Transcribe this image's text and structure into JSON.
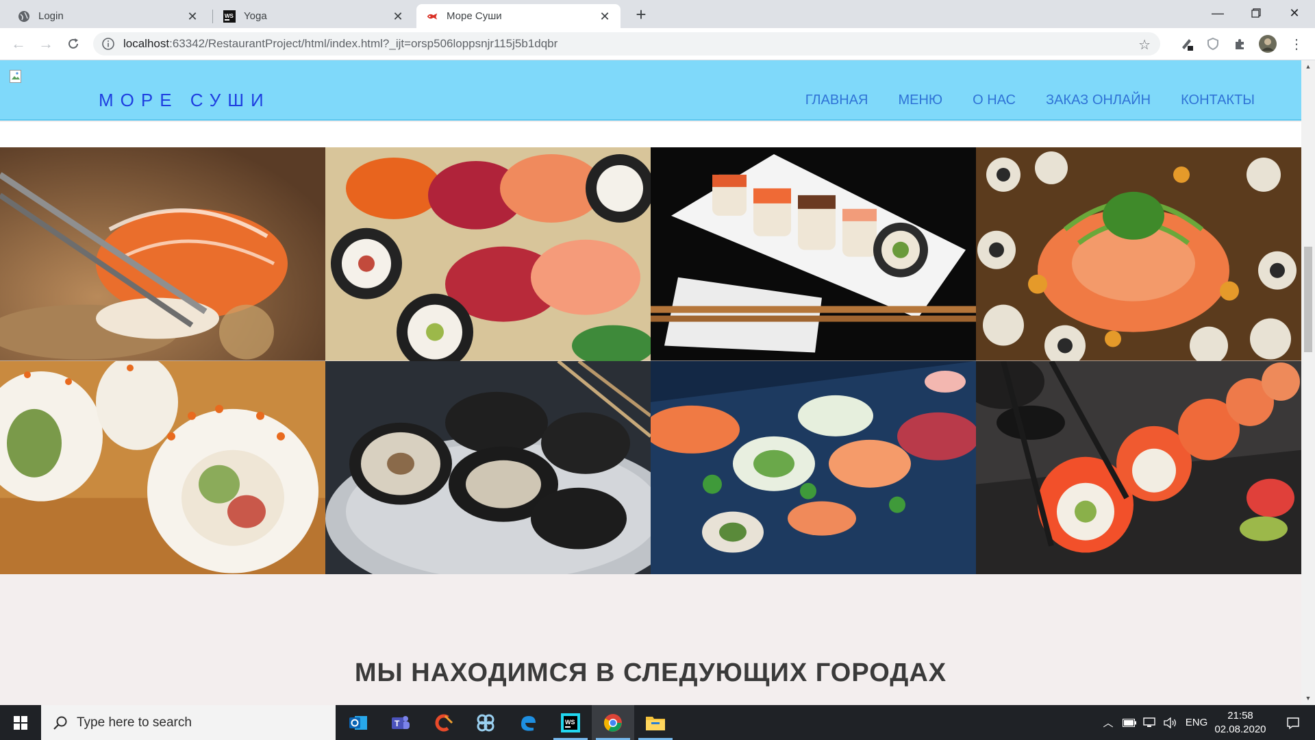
{
  "browser": {
    "tabs": [
      {
        "title": "Login",
        "icon": "globe-icon"
      },
      {
        "title": "Yoga",
        "icon": "webstorm-icon"
      },
      {
        "title": "Море Суши",
        "icon": "site-favicon-icon",
        "active": true
      }
    ],
    "url": {
      "host": "localhost",
      "rest": ":63342/RestaurantProject/html/index.html?_ijt=orsp506loppsnjr115j5b1dqbr"
    }
  },
  "site": {
    "brand": "МОРЕ СУШИ",
    "nav": [
      "ГЛАВНАЯ",
      "МЕНЮ",
      "О НАС",
      "ЗАКАЗ ОНЛАЙН",
      "КОНТАКТЫ"
    ],
    "cities_title": "МЫ НАХОДИМСЯ В СЛЕДУЮЩИХ ГОРОДАХ",
    "gallery": [
      "salmon-nigiri-chopsticks-photo",
      "assorted-sushi-platter-photo",
      "sushi-plate-black-background-photo",
      "sushi-rolls-salmon-set-photo",
      "california-rolls-closeup-photo",
      "dark-maki-rolls-plate-photo",
      "sushi-on-slate-photo",
      "salmon-roll-chopsticks-photo"
    ]
  },
  "taskbar": {
    "search_placeholder": "Type here to search",
    "language": "ENG",
    "time": "21:58",
    "date": "02.08.2020"
  }
}
